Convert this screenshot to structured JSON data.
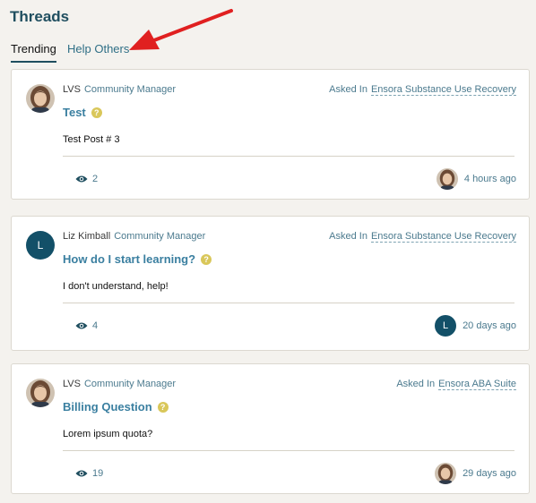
{
  "page": {
    "title": "Threads"
  },
  "tabs": [
    {
      "label": "Trending",
      "active": true
    },
    {
      "label": "Help Others",
      "active": false
    }
  ],
  "threads": [
    {
      "author": "LVS",
      "role": "Community Manager",
      "asked_prefix": "Asked In",
      "space": "Ensora Substance Use Recovery",
      "title": "Test",
      "body": "Test Post # 3",
      "views": "2",
      "time": "4 hours ago",
      "avatar_type": "photo"
    },
    {
      "author": "Liz Kimball",
      "role": "Community Manager",
      "asked_prefix": "Asked In",
      "space": "Ensora Substance Use Recovery",
      "title": "How do I start learning?",
      "body": "I don't understand, help!",
      "views": "4",
      "time": "20 days ago",
      "avatar_type": "letter",
      "avatar_letter": "L"
    },
    {
      "author": "LVS",
      "role": "Community Manager",
      "asked_prefix": "Asked In",
      "space": "Ensora ABA Suite",
      "title": "Billing Question",
      "body": "Lorem ipsum quota?",
      "views": "19",
      "time": "29 days ago",
      "avatar_type": "photo"
    }
  ],
  "colors": {
    "accent": "#1f4e5f",
    "link": "#3a7fa0",
    "question_badge": "#d9c75a",
    "arrow": "#e02020"
  }
}
